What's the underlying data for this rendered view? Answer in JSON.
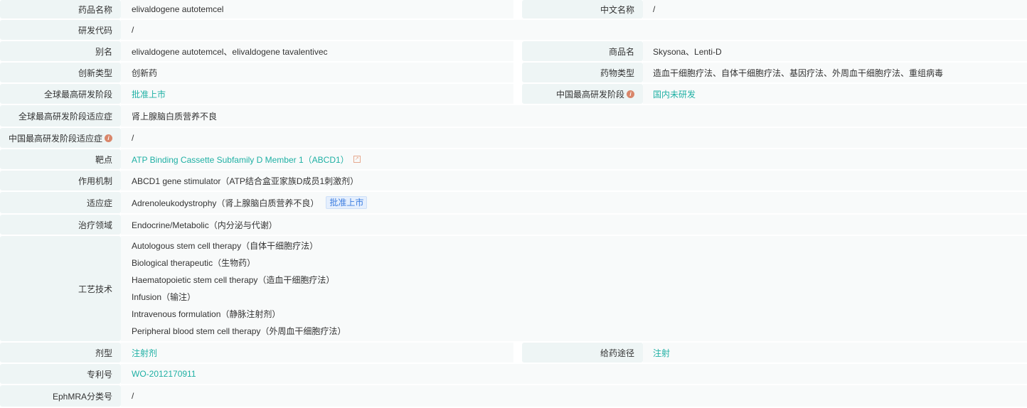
{
  "rows": {
    "drug_name": {
      "label": "药品名称",
      "value": "elivaldogene autotemcel"
    },
    "cn_name": {
      "label": "中文名称",
      "value": "/"
    },
    "code": {
      "label": "研发代码",
      "value": "/"
    },
    "alias": {
      "label": "别名",
      "value": "elivaldogene autotemcel、elivaldogene tavalentivec"
    },
    "trade": {
      "label": "商品名",
      "value": "Skysona、Lenti-D"
    },
    "innov": {
      "label": "创新类型",
      "value": "创新药"
    },
    "dtype": {
      "label": "药物类型",
      "value": "造血干细胞疗法、自体干细胞疗法、基因疗法、外周血干细胞疗法、重组病毒"
    },
    "global_phase": {
      "label": "全球最高研发阶段",
      "value": "批准上市"
    },
    "cn_phase": {
      "label": "中国最高研发阶段",
      "value": "国内未研发"
    },
    "global_ind": {
      "label": "全球最高研发阶段适应症",
      "value": "肾上腺脑白质营养不良"
    },
    "cn_ind": {
      "label": "中国最高研发阶段适应症",
      "value": "/"
    },
    "target": {
      "label": "靶点",
      "value": "ATP Binding Cassette Subfamily D Member 1（ABCD1）"
    },
    "mech": {
      "label": "作用机制",
      "value": "ABCD1 gene stimulator（ATP结合盒亚家族D成员1刺激剂）"
    },
    "indication": {
      "label": "适应症",
      "value": "Adrenoleukodystrophy（肾上腺脑白质营养不良）",
      "badge": "批准上市"
    },
    "area": {
      "label": "治疗领域",
      "value": "Endocrine/Metabolic（内分泌与代谢）"
    },
    "tech": {
      "label": "工艺技术",
      "values": [
        "Autologous stem cell therapy（自体干细胞疗法）",
        "Biological therapeutic（生物药）",
        "Haematopoietic stem cell therapy（造血干细胞疗法）",
        "Infusion（输注）",
        "Intravenous formulation（静脉注射剂）",
        "Peripheral blood stem cell therapy（外周血干细胞疗法）"
      ]
    },
    "form": {
      "label": "剂型",
      "value": "注射剂"
    },
    "route": {
      "label": "给药途径",
      "value": "注射"
    },
    "patent": {
      "label": "专利号",
      "value": "WO-2012170911"
    },
    "ephmra": {
      "label": "EphMRA分类号",
      "value": "/"
    }
  }
}
